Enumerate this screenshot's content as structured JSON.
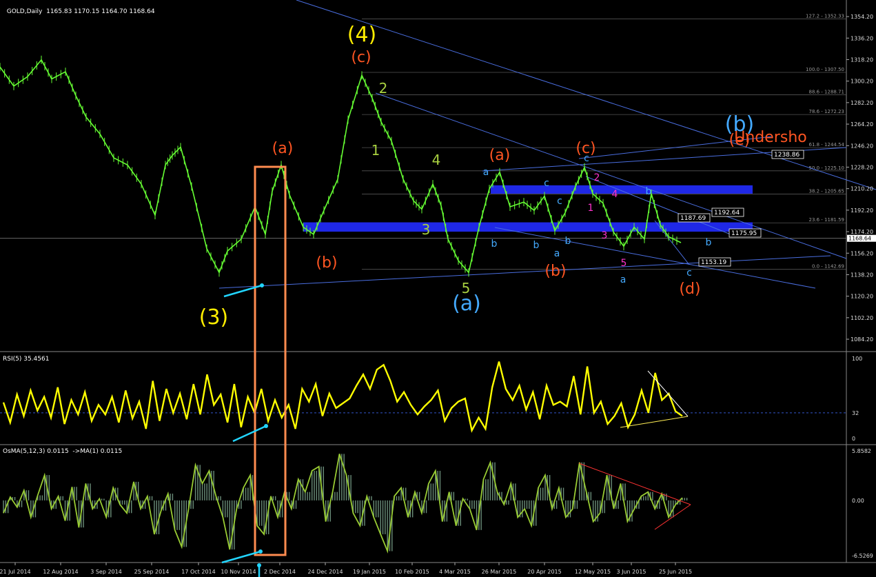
{
  "header": {
    "symbol": "GOLD,Daily",
    "ohlc": "1165.83 1170.15 1164.70 1168.64"
  },
  "rsi_panel": {
    "label": "RSI(5) 35.4561"
  },
  "osma_panel": {
    "label": "OsMA(5,12,3) 0.0115  ->MA(1) 0.0115"
  },
  "colors": {
    "background": "#000000",
    "price": "#66ff33",
    "rsi": "#ffff00",
    "osma_line": "#99cc33",
    "osma_hist": "#6b8e7a",
    "trendline": "#4a6ee0",
    "zone": "#1f28e6",
    "box": "#ff8c50",
    "arrow": "#22d5ff",
    "wave_yellow": "#ffee00",
    "wave_orange": "#ff5522",
    "wave_green": "#a8d040",
    "wave_blue": "#44aaff",
    "wave_magenta": "#ff33cc"
  },
  "chart_data": [
    {
      "type": "candlestick",
      "title": "GOLD,Daily",
      "ylim": [
        1075,
        1360
      ],
      "y_ticks": [
        "1354.20",
        "1336.20",
        "1318.20",
        "1300.20",
        "1282.20",
        "1264.20",
        "1246.20",
        "1228.20",
        "1210.20",
        "1192.20",
        "1174.20",
        "1156.20",
        "1138.20",
        "1120.20",
        "1102.20",
        "1084.20"
      ],
      "x_ticks": [
        "21 Jul 2014",
        "12 Aug 2014",
        "3 Sep 2014",
        "25 Sep 2014",
        "17 Oct 2014",
        "10 Nov 2014",
        "2 Dec 2014",
        "24 Dec 2014",
        "19 Jan 2015",
        "10 Feb 2015",
        "4 Mar 2015",
        "26 Mar 2015",
        "20 Apr 2015",
        "12 May 2015",
        "3 Jun 2015",
        "25 Jun 2015"
      ],
      "current_price": "1168.64",
      "price_path": [
        [
          0,
          1312
        ],
        [
          20,
          1296
        ],
        [
          40,
          1304
        ],
        [
          60,
          1318
        ],
        [
          75,
          1302
        ],
        [
          95,
          1308
        ],
        [
          110,
          1288
        ],
        [
          125,
          1270
        ],
        [
          145,
          1256
        ],
        [
          165,
          1236
        ],
        [
          185,
          1230
        ],
        [
          205,
          1214
        ],
        [
          225,
          1188
        ],
        [
          240,
          1230
        ],
        [
          250,
          1238
        ],
        [
          262,
          1245
        ],
        [
          278,
          1212
        ],
        [
          300,
          1160
        ],
        [
          318,
          1140
        ],
        [
          330,
          1158
        ],
        [
          350,
          1168
        ],
        [
          370,
          1195
        ],
        [
          385,
          1172
        ],
        [
          395,
          1208
        ],
        [
          408,
          1230
        ],
        [
          420,
          1205
        ],
        [
          440,
          1178
        ],
        [
          455,
          1172
        ],
        [
          470,
          1192
        ],
        [
          490,
          1218
        ],
        [
          505,
          1268
        ],
        [
          525,
          1305
        ],
        [
          540,
          1286
        ],
        [
          553,
          1266
        ],
        [
          568,
          1250
        ],
        [
          585,
          1218
        ],
        [
          600,
          1200
        ],
        [
          612,
          1193
        ],
        [
          628,
          1214
        ],
        [
          640,
          1196
        ],
        [
          650,
          1168
        ],
        [
          665,
          1150
        ],
        [
          680,
          1140
        ],
        [
          695,
          1178
        ],
        [
          710,
          1210
        ],
        [
          725,
          1224
        ],
        [
          740,
          1195
        ],
        [
          760,
          1199
        ],
        [
          775,
          1192
        ],
        [
          790,
          1204
        ],
        [
          805,
          1175
        ],
        [
          820,
          1190
        ],
        [
          835,
          1212
        ],
        [
          848,
          1228
        ],
        [
          860,
          1206
        ],
        [
          875,
          1198
        ],
        [
          890,
          1174
        ],
        [
          905,
          1162
        ],
        [
          920,
          1178
        ],
        [
          935,
          1168
        ],
        [
          945,
          1206
        ],
        [
          958,
          1180
        ],
        [
          970,
          1170
        ],
        [
          988,
          1165
        ]
      ],
      "fib_levels": [
        {
          "label": "127.2 - 1352.33",
          "value": 1352.33
        },
        {
          "label": "100.0 - 1307.50",
          "value": 1307.5
        },
        {
          "label": "88.6 - 1288.71",
          "value": 1288.71
        },
        {
          "label": "78.6 - 1272.23",
          "value": 1272.23
        },
        {
          "label": "61.8 - 1244.54",
          "value": 1244.54
        },
        {
          "label": "50.0 - 1225.10",
          "value": 1225.1
        },
        {
          "label": "38.2 - 1205.65",
          "value": 1205.65
        },
        {
          "label": "23.6 - 1181.59",
          "value": 1181.59
        },
        {
          "label": "0.0 - 1142.69",
          "value": 1142.69
        }
      ],
      "price_boxes": [
        "1238.86",
        "1192.64",
        "1187.69",
        "1175.95",
        "1153.19"
      ],
      "zones": [
        {
          "from": 1174.2,
          "to": 1182.0
        },
        {
          "from": 1206.0,
          "to": 1213.0
        }
      ],
      "wave_labels": [
        {
          "text": "(4)",
          "color": "wave_yellow",
          "size": "xl"
        },
        {
          "text": "(3)",
          "color": "wave_yellow",
          "size": "xl"
        },
        {
          "text": "(c)",
          "color": "wave_orange",
          "size": "l"
        },
        {
          "text": "(a)",
          "color": "wave_orange",
          "size": "l"
        },
        {
          "text": "(b)",
          "color": "wave_orange",
          "size": "l"
        },
        {
          "text": "(a)",
          "color": "wave_orange",
          "size": "l"
        },
        {
          "text": "(c)",
          "color": "wave_orange",
          "size": "l"
        },
        {
          "text": "(b)",
          "color": "wave_orange",
          "size": "l"
        },
        {
          "text": "(d)",
          "color": "wave_orange",
          "size": "l"
        },
        {
          "text": "(e)",
          "color": "wave_orange",
          "size": "l"
        },
        {
          "text": "Undersho",
          "color": "wave_orange",
          "size": "l"
        },
        {
          "text": "(b)",
          "color": "wave_blue",
          "size": "xl"
        },
        {
          "text": "(a)",
          "color": "wave_blue",
          "size": "xl"
        },
        {
          "text": "1",
          "color": "wave_green",
          "size": "m"
        },
        {
          "text": "2",
          "color": "wave_green",
          "size": "m"
        },
        {
          "text": "3",
          "color": "wave_green",
          "size": "m"
        },
        {
          "text": "4",
          "color": "wave_green",
          "size": "m"
        },
        {
          "text": "5",
          "color": "wave_green",
          "size": "m"
        },
        {
          "text": "a",
          "color": "wave_blue",
          "size": "s"
        },
        {
          "text": "b",
          "color": "wave_blue",
          "size": "s"
        },
        {
          "text": "c",
          "color": "wave_blue",
          "size": "s"
        },
        {
          "text": "1",
          "color": "wave_magenta",
          "size": "s"
        },
        {
          "text": "2",
          "color": "wave_magenta",
          "size": "s"
        },
        {
          "text": "3",
          "color": "wave_magenta",
          "size": "s"
        },
        {
          "text": "4",
          "color": "wave_magenta",
          "size": "s"
        },
        {
          "text": "5",
          "color": "wave_magenta",
          "size": "s"
        }
      ]
    },
    {
      "type": "line",
      "title": "RSI(5) 35.4561",
      "ylim": [
        0,
        100
      ],
      "y_ticks": [
        "100",
        "32",
        "0"
      ],
      "reference_level": 32,
      "values": [
        45,
        20,
        55,
        28,
        60,
        35,
        52,
        26,
        64,
        18,
        48,
        30,
        58,
        22,
        42,
        30,
        52,
        20,
        60,
        25,
        46,
        12,
        72,
        22,
        62,
        32,
        56,
        24,
        68,
        30,
        80,
        42,
        55,
        20,
        68,
        14,
        52,
        32,
        62,
        22,
        48,
        26,
        42,
        12,
        62,
        46,
        68,
        28,
        56,
        38,
        44,
        50,
        66,
        80,
        62,
        86,
        92,
        72,
        46,
        58,
        42,
        30,
        40,
        48,
        60,
        22,
        38,
        46,
        50,
        10,
        26,
        12,
        64,
        96,
        62,
        48,
        66,
        36,
        58,
        24,
        66,
        42,
        46,
        40,
        78,
        30,
        90,
        32,
        46,
        18,
        28,
        44,
        14,
        30,
        60,
        32,
        82,
        48,
        56,
        34,
        28
      ]
    },
    {
      "type": "bar",
      "title": "OsMA(5,12,3) 0.0115  ->MA(1) 0.0115",
      "ylim": [
        -6.5269,
        5.8582
      ],
      "y_ticks": [
        "5.8582",
        "0.00",
        "-6.5269"
      ],
      "values": [
        -1.5,
        0.4,
        -0.8,
        1.2,
        -2.0,
        0.6,
        3.0,
        -1.0,
        0.5,
        -2.4,
        1.6,
        -3.2,
        2.0,
        -1.0,
        0.2,
        -2.0,
        1.5,
        -0.5,
        -1.5,
        2.2,
        -1.0,
        0.5,
        -4.0,
        -1.2,
        0.8,
        -3.5,
        -5.5,
        -1.0,
        4.2,
        2.0,
        3.5,
        0.5,
        -2.0,
        -5.8,
        -1.0,
        1.5,
        3.0,
        -3.0,
        -4.0,
        0.5,
        -2.0,
        1.0,
        -1.0,
        2.5,
        1.0,
        3.5,
        4.0,
        -2.5,
        1.0,
        5.5,
        3.0,
        -1.5,
        -3.0,
        0.5,
        -2.0,
        -4.0,
        -6.0,
        0.5,
        1.5,
        -2.0,
        1.0,
        -1.5,
        2.0,
        3.5,
        -2.5,
        1.0,
        -3.0,
        0.2,
        -1.0,
        -3.5,
        2.5,
        4.5,
        1.0,
        -0.5,
        2.0,
        -2.0,
        -1.0,
        -3.0,
        1.5,
        3.0,
        -1.0,
        1.5,
        -2.0,
        -1.0,
        4.5,
        1.0,
        -2.5,
        -1.5,
        3.0,
        -1.0,
        2.0,
        -2.5,
        -1.0,
        0.5,
        1.0,
        -1.0,
        0.8,
        -2.0,
        -0.5,
        0.3
      ]
    }
  ]
}
